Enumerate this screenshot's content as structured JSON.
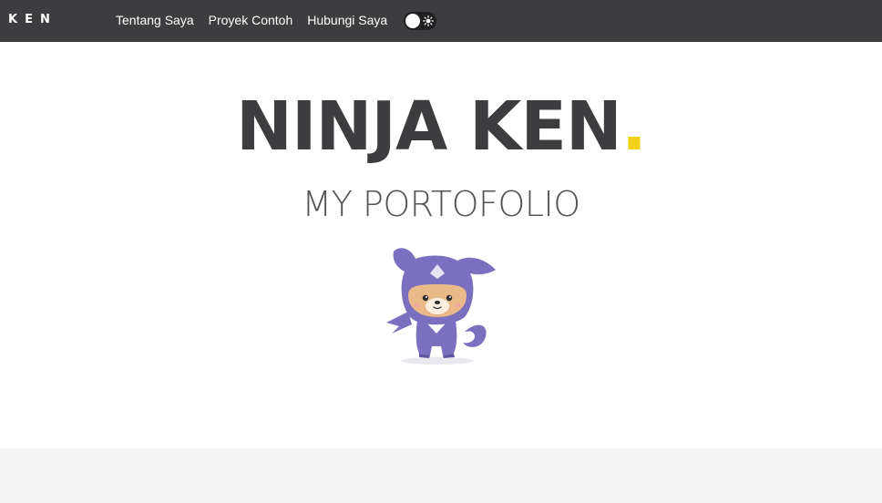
{
  "nav": {
    "brand": "KEN",
    "links": [
      "Tentang Saya",
      "Proyek Contoh",
      "Hubungi Saya"
    ],
    "theme_toggle_icon": "sun-icon"
  },
  "hero": {
    "title": "NINJA KEN",
    "title_dot": ".",
    "subtitle": "MY PORTOFOLIO",
    "mascot_icon": "ninja-dog-mascot"
  },
  "colors": {
    "navbar": "#3d3d3f",
    "accent_dot": "#f2d21b",
    "mascot_purple": "#7a70bf",
    "footer_band": "#f4f4f4"
  }
}
